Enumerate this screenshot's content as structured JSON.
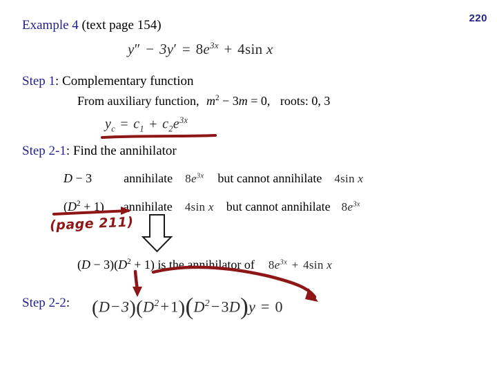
{
  "slide": {
    "page_number": "220",
    "background_color": "#ffffff",
    "heading_color": "#1f1f8f",
    "ink_color": "#8d1616",
    "math_color": "#2b2b2b"
  },
  "title": {
    "label_blue": "Example 4",
    "label_black": "(text page 154)"
  },
  "main_equation": {
    "lhs_y": "y",
    "lhs_primes": "″",
    "minus": "−",
    "three": "3",
    "y2": "y",
    "prime": "′",
    "equals": "=",
    "eight": "8",
    "e": "e",
    "exp_3x": "3x",
    "plus": "+",
    "four": "4",
    "sin": "sin",
    "x": "x",
    "plain": "y″ − 3y′ = 8e^{3x} + 4 sin x"
  },
  "step1": {
    "label_blue": "Step 1",
    "label_black": ":  Complementary function",
    "aux_prefix": "From auxiliary function,",
    "aux_m": "m",
    "aux_sup": "2",
    "aux_mid": "− 3",
    "aux_m2": "m",
    "aux_eq": "= 0,",
    "roots_label": "roots: 0, 3",
    "yc_plain": "y_c = c₁ + c₂ e^{3x}"
  },
  "step21": {
    "label_blue": "Step 2-1",
    "label_black": ": Find the annihilator",
    "rows": [
      {
        "operator": "D − 3",
        "verb": "annihilate",
        "target": "8e^{3x}",
        "contrast": "but cannot annihilate",
        "other": "4 sin x"
      },
      {
        "operator": "(D² + 1)",
        "verb": "annihilate",
        "target": "4 sin x",
        "contrast": "but cannot annihilate",
        "other": "8e^{3x}"
      }
    ],
    "conclusion_prefix": "(D − 3)(D",
    "conclusion_sup": "2",
    "conclusion_mid": " + 1) is the annihilator of",
    "conclusion_expr": "8e^{3x} + 4 sin x"
  },
  "step22": {
    "label_blue": "Step 2-2",
    "label_black": ":",
    "equation_plain": "(D − 3)(D² + 1)(D² − 3D) y = 0"
  },
  "annotations": {
    "handwritten_note": "(page 211)",
    "underline_yc": "red-underline-under-complementary-function",
    "arrow_under_d2plus1": "red-right-arrow",
    "block_arrow": "hollow-down-block-arrow",
    "arrow_to_step22_left": "red-down-arrow",
    "arrow_to_step22_right": "red-curved-arrow"
  }
}
